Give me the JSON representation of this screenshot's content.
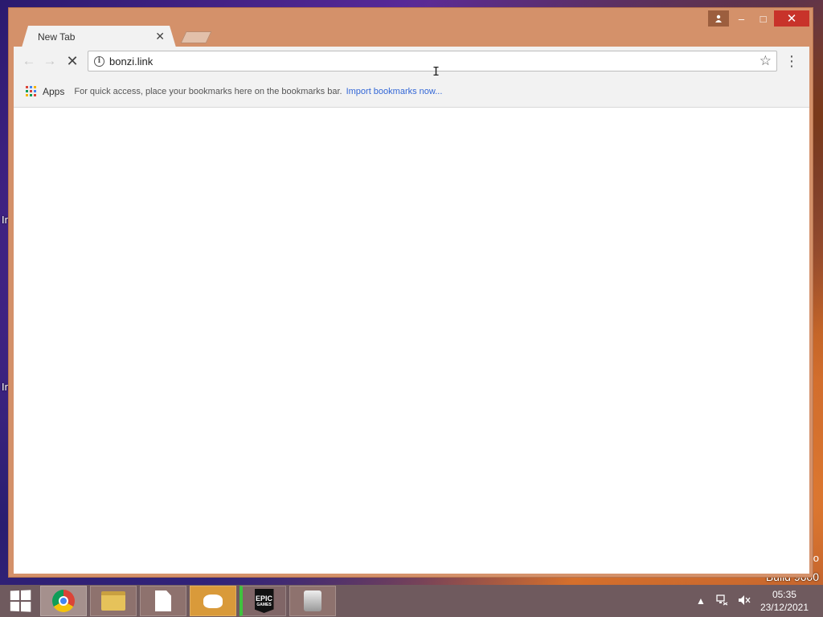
{
  "browser": {
    "tab": {
      "title": "New Tab"
    },
    "address_bar": {
      "value": "bonzi.link"
    },
    "bookmarks_bar": {
      "apps_label": "Apps",
      "hint": "For quick access, place your bookmarks here on the bookmarks bar.",
      "import_link": "Import bookmarks now..."
    },
    "caption_buttons": {
      "minimize": "–",
      "maximize": "□",
      "close": "✕"
    },
    "icons": {
      "info": "i",
      "star": "☆",
      "menu": "⋮",
      "back": "←",
      "forward": "→",
      "stop": "✕"
    }
  },
  "desktop": {
    "fragments": [
      "Ir",
      "Ir"
    ],
    "watermark_partial": "o",
    "watermark_build": "Build 9600"
  },
  "taskbar": {
    "items": [
      {
        "name": "chrome",
        "icon": "chrome-icon"
      },
      {
        "name": "file-explorer",
        "icon": "folder-icon"
      },
      {
        "name": "document",
        "icon": "file-icon"
      },
      {
        "name": "discord",
        "icon": "discord-icon"
      },
      {
        "name": "epic-games",
        "icon": "epic-games-icon",
        "label": "EPIC",
        "sublabel": "GAMES"
      },
      {
        "name": "app",
        "icon": "app-icon"
      }
    ],
    "clock": {
      "time": "05:35",
      "date": "23/12/2021"
    }
  }
}
